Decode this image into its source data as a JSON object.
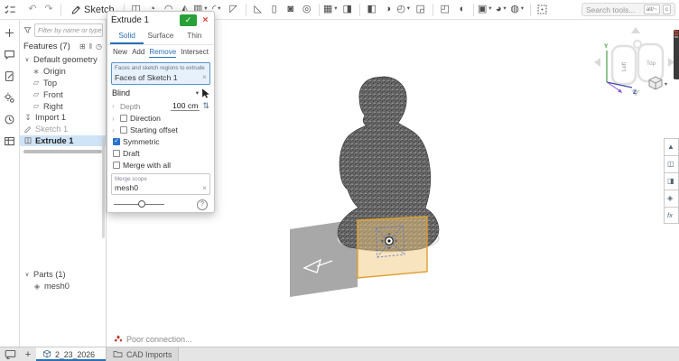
{
  "colors": {
    "accent_blue": "#2b6fb5",
    "selection_bg": "#cfe4f7",
    "confirm_green": "#28a038",
    "cancel_red": "#d63a2f",
    "plane_orange": "#dd9f33",
    "plane_orange_fill": "#f2c97e",
    "gray_plane": "#a8a8a8",
    "sketch_blue": "#5b79cf"
  },
  "topbar": {
    "sketch_label": "Sketch",
    "search": {
      "placeholder": "Search tools...",
      "shortcuts": [
        "alt/~",
        "c"
      ]
    },
    "groups": [
      {
        "items": [
          {
            "icon": "undo-icon",
            "muted": true
          },
          {
            "icon": "redo-icon",
            "muted": true
          }
        ]
      },
      {
        "items": [
          {
            "icon": "sketch-pencil-icon",
            "label": "Sketch"
          }
        ]
      },
      {
        "items": [
          {
            "icon": "extrude-icon"
          },
          {
            "icon": "revolve-icon"
          },
          {
            "icon": "sweep-icon"
          },
          {
            "icon": "loft-icon"
          },
          {
            "icon": "thicken-icon",
            "caret": true
          },
          {
            "icon": "fillet-icon",
            "caret": true
          },
          {
            "icon": "chamfer-icon"
          }
        ]
      },
      {
        "items": [
          {
            "icon": "draft-icon"
          },
          {
            "icon": "rib-icon"
          },
          {
            "icon": "shell-icon"
          },
          {
            "icon": "hole-icon"
          }
        ]
      },
      {
        "items": [
          {
            "icon": "linear-pattern-icon",
            "caret": true
          },
          {
            "icon": "mirror-icon"
          }
        ]
      },
      {
        "items": [
          {
            "icon": "boolean-icon"
          },
          {
            "icon": "split-icon"
          },
          {
            "icon": "modify-fillet-icon",
            "caret": true
          },
          {
            "icon": "delete-face-icon"
          }
        ]
      },
      {
        "items": [
          {
            "icon": "move-face-icon"
          },
          {
            "icon": "offset-surface-icon"
          }
        ]
      },
      {
        "items": [
          {
            "icon": "plane-tool-icon",
            "caret": true
          },
          {
            "icon": "measure-icon",
            "caret": true
          },
          {
            "icon": "tag-icon",
            "caret": true
          }
        ]
      },
      {
        "items": [
          {
            "icon": "select-region-icon"
          }
        ]
      }
    ]
  },
  "left_rail": {
    "icons": [
      "datum-icon",
      "comments-icon",
      "edit-document-icon",
      "configurations-icon",
      "versions-icon",
      "tables-icon"
    ]
  },
  "feature_panel": {
    "filter_placeholder": "Filter by name or type",
    "header": {
      "title": "Features (7)",
      "icons": [
        "add-folder-icon",
        "suppress-icon",
        "rollback-icon"
      ]
    },
    "tree": [
      {
        "label": "Default geometry",
        "chevron": true,
        "depth": 0
      },
      {
        "label": "Origin",
        "icon": "origin-icon",
        "depth": 1
      },
      {
        "label": "Top",
        "icon": "plane-feature-icon",
        "depth": 1
      },
      {
        "label": "Front",
        "icon": "plane-feature-icon",
        "depth": 1
      },
      {
        "label": "Right",
        "icon": "plane-feature-icon",
        "depth": 1
      },
      {
        "label": "Import 1",
        "icon": "import-icon",
        "depth": 0
      },
      {
        "label": "Sketch 1",
        "icon": "sketch-feature-icon",
        "depth": 0,
        "state": "suppressed"
      },
      {
        "label": "Extrude 1",
        "icon": "extrude-feature-icon",
        "depth": 0,
        "state": "selected"
      }
    ],
    "parts": {
      "header": "Parts (1)",
      "items": [
        {
          "label": "mesh0",
          "icon": "mesh-part-icon"
        }
      ]
    }
  },
  "dialog": {
    "title": "Extrude 1",
    "tabs": [
      {
        "label": "Solid",
        "active": true
      },
      {
        "label": "Surface"
      },
      {
        "label": "Thin"
      }
    ],
    "modes": [
      {
        "label": "New"
      },
      {
        "label": "Add"
      },
      {
        "label": "Remove",
        "active": true
      },
      {
        "label": "Intersect"
      }
    ],
    "selection": {
      "label": "Faces and sketch regions to extrude",
      "value": "Faces of Sketch 1"
    },
    "end_condition": "Blind",
    "depth": {
      "label": "Depth",
      "value": "100 cm"
    },
    "expanders": [
      {
        "label": "Direction"
      },
      {
        "label": "Starting offset"
      }
    ],
    "checks": [
      {
        "label": "Symmetric",
        "checked": true
      },
      {
        "label": "Draft",
        "checked": false
      },
      {
        "label": "Merge with all",
        "checked": false
      }
    ],
    "merge_scope": {
      "label": "Merge scope",
      "value": "mesh0"
    },
    "help_label": "?"
  },
  "viewcube": {
    "faces": [
      "Left",
      "Top"
    ],
    "axis_y": "Y",
    "axis_z": "Z"
  },
  "right_rail": {
    "buttons": [
      {
        "icon": "isolate-icon"
      },
      {
        "icon": "named-views-icon"
      },
      {
        "icon": "display-states-icon"
      },
      {
        "icon": "appearance-icon"
      },
      {
        "icon": "fx-variables-icon",
        "label": "fx"
      }
    ]
  },
  "status": {
    "message": "Poor connection..."
  },
  "bottom_bar": {
    "new_tab_label": "+",
    "tabs": [
      {
        "label": "2_23_2026",
        "icon": "part-studio-icon",
        "active": true
      },
      {
        "label": "CAD Imports",
        "icon": "folder-icon",
        "active": false
      }
    ]
  }
}
